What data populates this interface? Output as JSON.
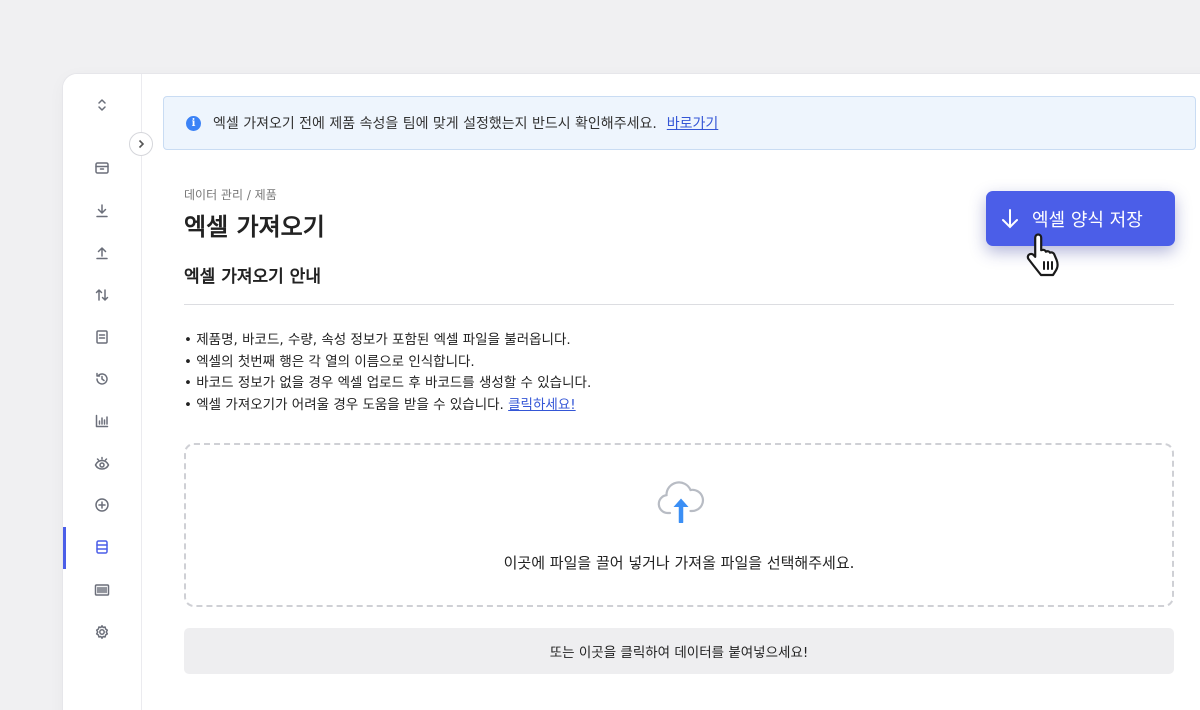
{
  "notice": {
    "message": "엑셀 가져오기 전에 제품 속성을 팀에 맞게 설정했는지 반드시 확인해주세요.",
    "link": "바로가기",
    "icon": "info-icon"
  },
  "breadcrumb": "데이터 관리 / 제품",
  "page_title": "엑셀 가져오기",
  "download_button": {
    "label": "엑셀 양식 저장",
    "icon": "arrow-down-icon"
  },
  "guide": {
    "title": "엑셀 가져오기 안내",
    "items": [
      "제품명, 바코드, 수량, 속성 정보가 포함된 엑셀 파일을 불러옵니다.",
      "엑셀의 첫번째 행은 각 열의 이름으로 인식합니다.",
      "바코드 정보가 없을 경우 엑셀 업로드 후 바코드를 생성할 수 있습니다.",
      "엑셀 가져오기가 어려울 경우 도움을 받을 수 있습니다."
    ],
    "help_link": "클릭하세요!"
  },
  "dropzone": {
    "text": "이곳에 파일을 끌어 넣거나 가져올 파일을 선택해주세요.",
    "icon": "cloud-upload-icon"
  },
  "paste_button": "또는 이곳을 클릭하여 데이터를 붙여넣으세요!",
  "sidebar": {
    "items": [
      {
        "name": "switch-icon"
      },
      {
        "name": "box-icon"
      },
      {
        "name": "download-icon"
      },
      {
        "name": "upload-icon"
      },
      {
        "name": "transfer-icon"
      },
      {
        "name": "document-icon"
      },
      {
        "name": "history-icon"
      },
      {
        "name": "chart-icon"
      },
      {
        "name": "eye-icon"
      },
      {
        "name": "plus-circle-icon"
      },
      {
        "name": "data-icon",
        "active": true
      },
      {
        "name": "barcode-icon"
      },
      {
        "name": "settings-icon"
      }
    ]
  },
  "colors": {
    "accent": "#4b5ee8",
    "link": "#3456d6",
    "info": "#3b82f6",
    "upload": "#3b8ff5"
  }
}
